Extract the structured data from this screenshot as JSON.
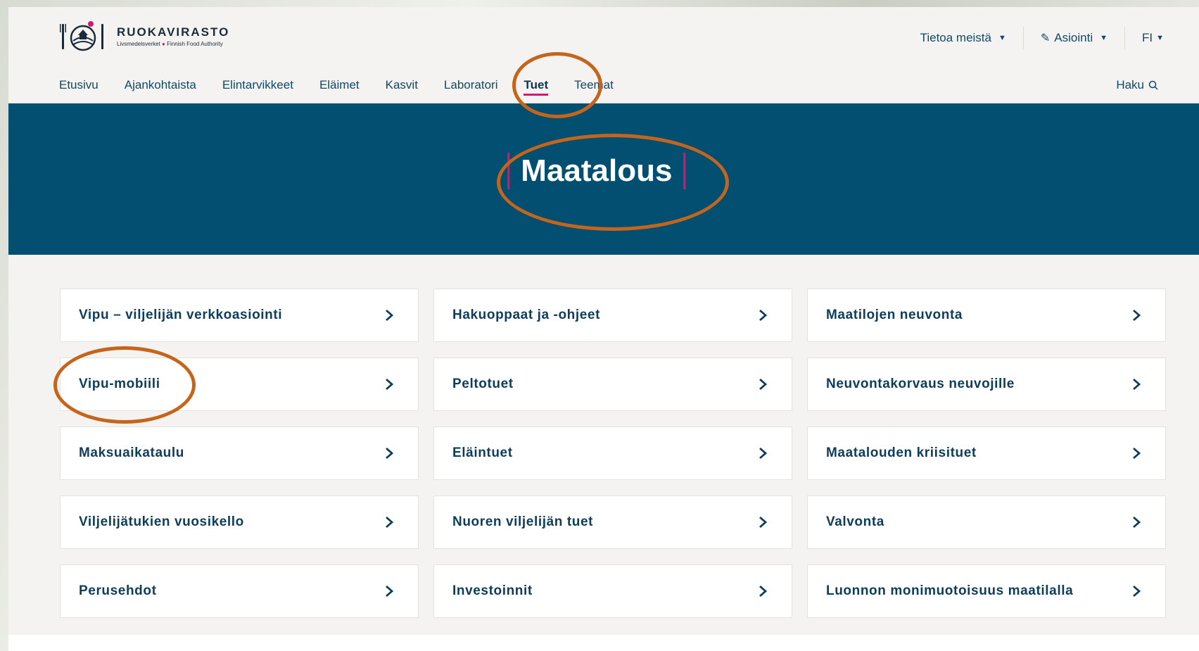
{
  "brand": {
    "name": "RUOKAVIRASTO",
    "sub_a": "Livsmedelsverket",
    "sub_b": "Finnish Food Authority",
    "dot_color": "#d1196e"
  },
  "top_links": {
    "about": "Tietoa meistä",
    "services": "Asiointi",
    "language": "FI"
  },
  "nav": {
    "items": [
      "Etusivu",
      "Ajankohtaista",
      "Elintarvikkeet",
      "Eläimet",
      "Kasvit",
      "Laboratori",
      "Tuet",
      "Teemat"
    ],
    "active": "Tuet",
    "search_label": "Haku"
  },
  "hero": {
    "title": "Maatalous"
  },
  "cards": [
    [
      "Vipu – viljelijän verkkoasiointi",
      "Hakuoppaat ja -ohjeet",
      "Maatilojen neuvonta"
    ],
    [
      "Vipu-mobiili",
      "Peltotuet",
      "Neuvontakorvaus neuvojille"
    ],
    [
      "Maksuaikataulu",
      "Eläintuet",
      "Maatalouden kriisituet"
    ],
    [
      "Viljelijätukien vuosikello",
      "Nuoren viljelijän tuet",
      "Valvonta"
    ],
    [
      "Perusehdot",
      "Investoinnit",
      "Luonnon monimuotoisuus maatilalla"
    ]
  ],
  "colors": {
    "primary": "#024f72",
    "accent": "#d1196e",
    "annotation": "#c4651b",
    "text_dark": "#0d3d5a"
  }
}
